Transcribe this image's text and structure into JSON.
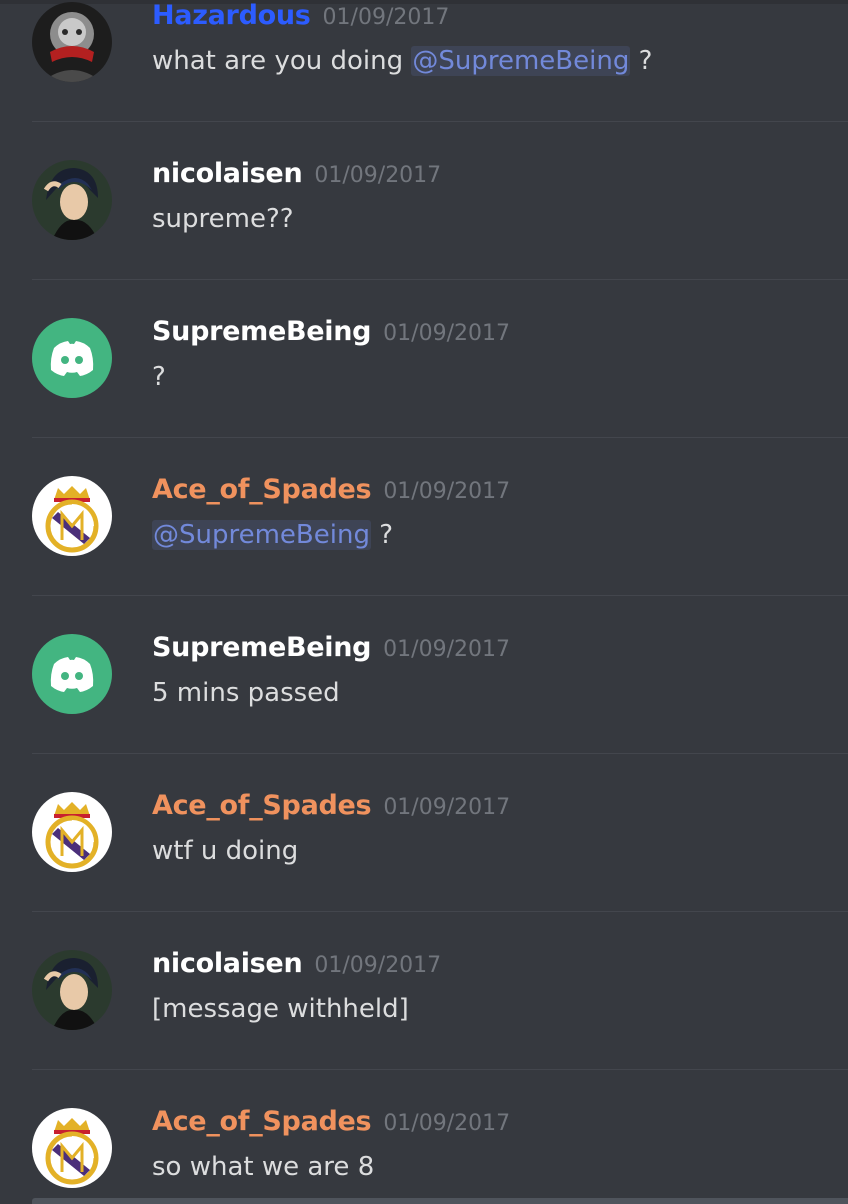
{
  "messages": [
    {
      "author": "Hazardous",
      "author_color": "#2c5cff",
      "timestamp": "01/09/2017",
      "avatar": "hazardous-avatar",
      "pre": "what are you doing ",
      "mention": "@SupremeBeing",
      "post": " ?"
    },
    {
      "author": "nicolaisen",
      "author_color": "#ffffff",
      "timestamp": "01/09/2017",
      "avatar": "anime-avatar",
      "pre": "supreme??",
      "mention": "",
      "post": ""
    },
    {
      "author": "SupremeBeing",
      "author_color": "#ffffff",
      "timestamp": "01/09/2017",
      "avatar": "discord-default-avatar",
      "pre": "?",
      "mention": "",
      "post": ""
    },
    {
      "author": "Ace_of_Spades",
      "author_color": "#f0925e",
      "timestamp": "01/09/2017",
      "avatar": "crest-avatar",
      "pre": "",
      "mention": "@SupremeBeing",
      "post": " ?"
    },
    {
      "author": "SupremeBeing",
      "author_color": "#ffffff",
      "timestamp": "01/09/2017",
      "avatar": "discord-default-avatar",
      "pre": "5 mins passed",
      "mention": "",
      "post": ""
    },
    {
      "author": "Ace_of_Spades",
      "author_color": "#f0925e",
      "timestamp": "01/09/2017",
      "avatar": "crest-avatar",
      "pre": "wtf u doing",
      "mention": "",
      "post": ""
    },
    {
      "author": "nicolaisen",
      "author_color": "#ffffff",
      "timestamp": "01/09/2017",
      "avatar": "anime-avatar",
      "pre": "[message withheld]",
      "mention": "",
      "post": ""
    },
    {
      "author": "Ace_of_Spades",
      "author_color": "#f0925e",
      "timestamp": "01/09/2017",
      "avatar": "crest-avatar",
      "pre": "so what we are 8",
      "mention": "",
      "post": ""
    }
  ],
  "colors": {
    "background": "#36393f",
    "mention": "#7289da",
    "timestamp": "#72767d",
    "text": "#dcddde",
    "discord_green": "#43b581"
  }
}
